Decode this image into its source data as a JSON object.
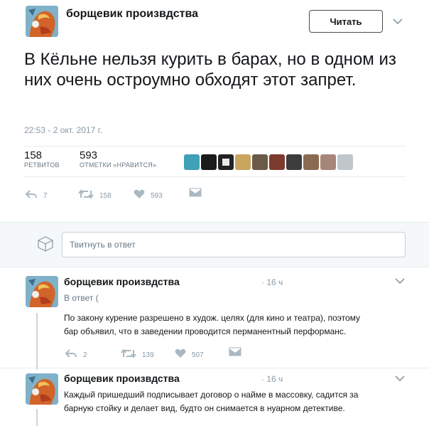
{
  "main_tweet": {
    "username": "борщевик произвдства",
    "follow_label": "Читать",
    "text": "В Кёльне нельзя курить в барах, но в одном из них  очень остроумно обходят этот запрет.",
    "timestamp": "22:53 - 2 окт. 2017 г.",
    "stats": {
      "retweets_count": "158",
      "retweets_label": "РЕТВИТОВ",
      "likes_count": "593",
      "likes_label": "ОТМЕТКИ «НРАВИТСЯ»"
    },
    "actions": {
      "reply": "7",
      "retweet": "158",
      "like": "593"
    }
  },
  "reply_box": {
    "placeholder": "Твитнуть в ответ"
  },
  "replies": [
    {
      "username": "борщевик произвдства",
      "time": "· 16 ч",
      "reply_to": "В ответ (",
      "text_lines": [
        "По закону курение разрешено в худож. целях (для кино и театра), поэтому",
        "бар объявил, что в заведении проводится перманентный перформанс."
      ],
      "actions": {
        "reply": "2",
        "retweet": "139",
        "like": "507"
      }
    },
    {
      "username": "борщевик произвдства",
      "time": "· 16 ч",
      "text_lines": [
        "Каждый пришедший подписывает договор о найме в массовку, садится за",
        "барную стойку и делает вид, будто он снимается в нуарном детективе."
      ]
    }
  ],
  "icons": {
    "reply": "reply-icon",
    "retweet": "retweet-icon",
    "like": "heart-icon",
    "dm": "envelope-icon",
    "more": "chevron-down-icon"
  },
  "colors": {
    "text": "#14171a",
    "muted": "#8899a6",
    "divider": "#e6ecf0"
  }
}
